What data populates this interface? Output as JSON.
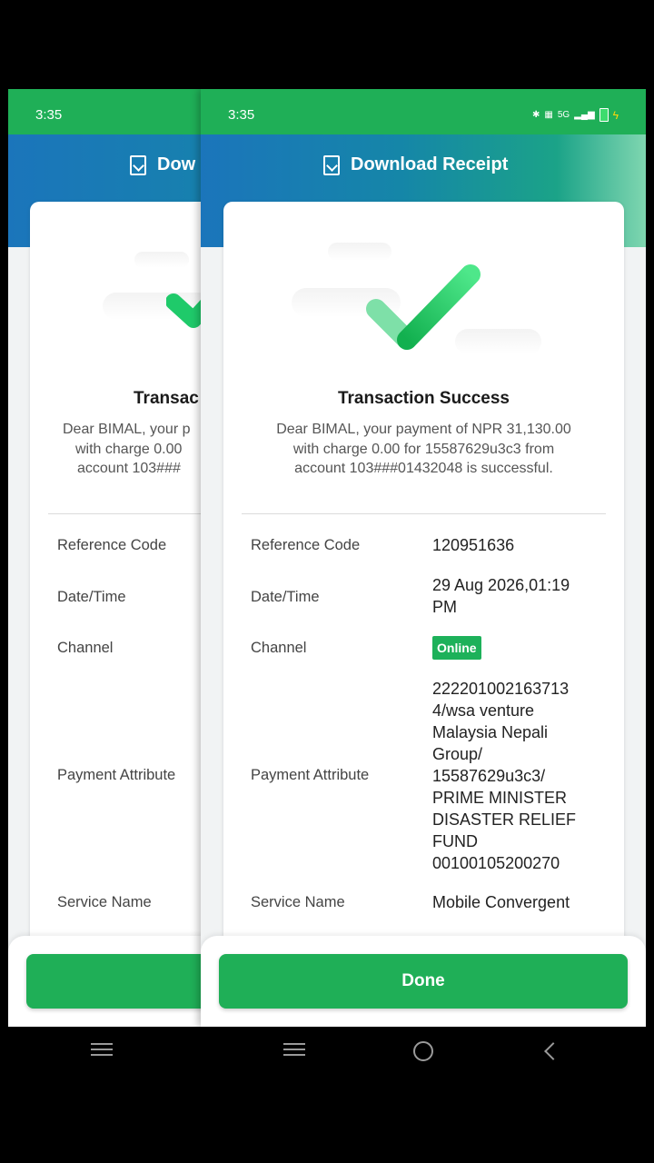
{
  "status_bar": {
    "time": "3:35",
    "network": "5G"
  },
  "header": {
    "title": "Download Receipt"
  },
  "receipt": {
    "title": "Transaction Success",
    "message_lines": [
      "Dear BIMAL, your payment of NPR 31,130.00",
      "with charge 0.00 for 15587629u3c3 from",
      "account 103###01432048 is successful."
    ],
    "rows": {
      "reference_code": {
        "label": "Reference Code",
        "value": "120951636"
      },
      "date_time": {
        "label": "Date/Time",
        "value_lines": [
          "29 Aug 2026,01:19",
          "PM"
        ]
      },
      "channel": {
        "label": "Channel",
        "value": "Online"
      },
      "payment_attribute": {
        "label": "Payment Attribute",
        "value_lines": [
          "222201002163713",
          "4/wsa venture",
          "Malaysia Nepali",
          "Group/",
          "15587629u3c3/",
          "PRIME MINISTER",
          "DISASTER RELIEF",
          "FUND",
          "00100105200270"
        ]
      },
      "service_name": {
        "label": "Service Name",
        "value": "Mobile Convergent"
      }
    }
  },
  "back_screen": {
    "header_title": "Dow",
    "receipt_title": "Transac",
    "message_lines": [
      "Dear BIMAL, your p",
      "with charge 0.00",
      "account 103###"
    ]
  },
  "actions": {
    "done_label": "Done"
  },
  "icons": [
    "download-receipt-icon",
    "success-check-icon",
    "recents-menu-icon",
    "home-icon",
    "back-icon"
  ],
  "colors": {
    "brand_green": "#1faf57",
    "header_blue": "#1b75bb",
    "badge_green": "#1db15a"
  }
}
